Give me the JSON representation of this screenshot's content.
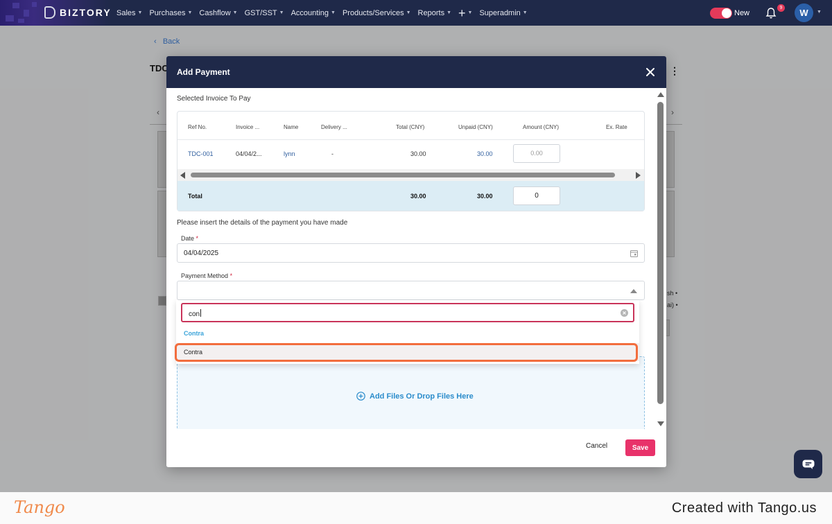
{
  "app": {
    "brand": "BIZTORY",
    "menu": [
      {
        "label": "Sales"
      },
      {
        "label": "Purchases"
      },
      {
        "label": "Cashflow"
      },
      {
        "label": "GST/SST"
      },
      {
        "label": "Accounting"
      },
      {
        "label": "Products/Services"
      },
      {
        "label": "Reports"
      },
      {
        "label": "Superadmin"
      }
    ],
    "plus_icon": "+",
    "toggle_label": "New",
    "notification_count": "9",
    "avatar_initial": "W",
    "accent": "#e53a5a",
    "nav_bg": "#1f2949"
  },
  "background_page": {
    "back_label": "Back",
    "title": "TDC",
    "side_text_1": "sh •",
    "side_text_2": "ai) •"
  },
  "modal": {
    "title": "Add Payment",
    "selected_label": "Selected Invoice To Pay",
    "columns": [
      "Ref No.",
      "Invoice ...",
      "Name",
      "Delivery ...",
      "Total (CNY)",
      "Unpaid (CNY)",
      "Amount (CNY)",
      "Ex. Rate"
    ],
    "row": {
      "ref": "TDC-001",
      "invoice_date": "04/04/2...",
      "name": "lynn",
      "delivery": "-",
      "total": "30.00",
      "unpaid": "30.00",
      "amount_placeholder": "0.00"
    },
    "total_row": {
      "label": "Total",
      "total": "30.00",
      "unpaid": "30.00",
      "amount": "0"
    },
    "details_label": "Please insert the details of the payment you have made",
    "date_label": "Date",
    "required_mark": "*",
    "date_value": "04/04/2025",
    "payment_method_label": "Payment Method",
    "dropdown": {
      "search_value": "con",
      "group_header": "Contra",
      "option_label": "Contra"
    },
    "upload_text": "Add Files  Or Drop Files Here",
    "cancel_label": "Cancel",
    "save_label": "Save",
    "save_color": "#e8326a"
  },
  "footer": {
    "logo": "Tango",
    "created_with": "Created with Tango.us"
  }
}
